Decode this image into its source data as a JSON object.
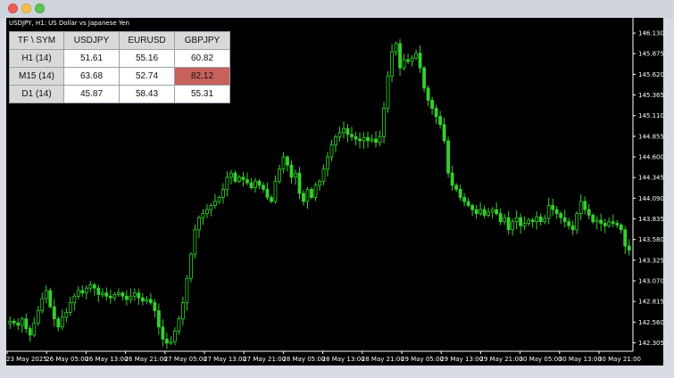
{
  "window": {
    "title_bar_buttons": [
      "close",
      "minimize",
      "zoom"
    ]
  },
  "chart_title": "USDJPY, H1:  US Dollar vs Japanese Yen",
  "table": {
    "headers": [
      "TF \\ SYM",
      "USDJPY",
      "EURUSD",
      "GBPJPY"
    ],
    "rows": [
      {
        "tf": "H1 (14)",
        "values": [
          "51.61",
          "55.16",
          "60.82"
        ]
      },
      {
        "tf": "M15 (14)",
        "values": [
          "63.68",
          "52.74",
          "82.12"
        ]
      },
      {
        "tf": "D1 (14)",
        "values": [
          "45.87",
          "58.43",
          "55.31"
        ]
      }
    ],
    "highlight": {
      "row": 1,
      "col": 2,
      "color": "#c8605b"
    }
  },
  "chart_data": {
    "type": "candlestick",
    "symbol": "USDJPY",
    "timeframe": "H1",
    "y_ticks": [
      "146.130",
      "145.875",
      "145.620",
      "145.365",
      "145.110",
      "144.855",
      "144.600",
      "144.345",
      "144.090",
      "143.835",
      "143.580",
      "143.325",
      "143.070",
      "142.815",
      "142.560",
      "142.305"
    ],
    "ylim": [
      142.2,
      146.23
    ],
    "x_ticks": [
      "23 May 2025",
      "26 May 05:00",
      "26 May 13:00",
      "26 May 21:00",
      "27 May 05:00",
      "27 May 13:00",
      "27 May 21:00",
      "28 May 05:00",
      "28 May 13:00",
      "28 May 21:00",
      "29 May 05:00",
      "29 May 13:00",
      "29 May 21:00",
      "30 May 05:00",
      "30 May 13:00",
      "30 May 21:00"
    ],
    "candle_color": "#34d12c",
    "close_path": [
      142.57,
      142.55,
      142.52,
      142.6,
      142.48,
      142.4,
      142.55,
      142.7,
      142.85,
      142.95,
      142.75,
      142.6,
      142.5,
      142.62,
      142.68,
      142.8,
      142.88,
      142.95,
      142.92,
      142.98,
      143.02,
      142.98,
      142.9,
      142.92,
      142.88,
      142.86,
      142.9,
      142.92,
      142.88,
      142.84,
      142.88,
      142.92,
      142.86,
      142.82,
      142.84,
      142.8,
      142.7,
      142.5,
      142.35,
      142.3,
      142.32,
      142.45,
      142.6,
      142.8,
      143.1,
      143.4,
      143.7,
      143.85,
      143.9,
      143.95,
      144.0,
      144.05,
      144.1,
      144.2,
      144.35,
      144.4,
      144.3,
      144.35,
      144.32,
      144.28,
      144.22,
      144.3,
      144.25,
      144.2,
      144.1,
      144.05,
      144.3,
      144.45,
      144.6,
      144.5,
      144.35,
      144.4,
      144.15,
      144.05,
      144.2,
      144.1,
      144.25,
      144.3,
      144.45,
      144.6,
      144.75,
      144.85,
      144.9,
      144.95,
      144.88,
      144.85,
      144.82,
      144.8,
      144.84,
      144.8,
      144.82,
      144.78,
      144.85,
      145.2,
      145.6,
      145.9,
      146.0,
      145.7,
      145.8,
      145.78,
      145.82,
      145.88,
      145.7,
      145.45,
      145.3,
      145.2,
      145.1,
      145.0,
      144.8,
      144.4,
      144.25,
      144.2,
      144.1,
      144.05,
      144.0,
      143.95,
      143.9,
      143.95,
      143.88,
      143.92,
      143.95,
      143.9,
      143.8,
      143.85,
      143.7,
      143.8,
      143.85,
      143.75,
      143.78,
      143.82,
      143.8,
      143.86,
      143.8,
      143.84,
      144.0,
      143.95,
      143.9,
      143.85,
      143.8,
      143.75,
      143.7,
      143.9,
      144.05,
      143.95,
      143.88,
      143.8,
      143.82,
      143.78,
      143.75,
      143.8,
      143.78,
      143.76,
      143.7,
      143.5,
      143.45
    ]
  }
}
